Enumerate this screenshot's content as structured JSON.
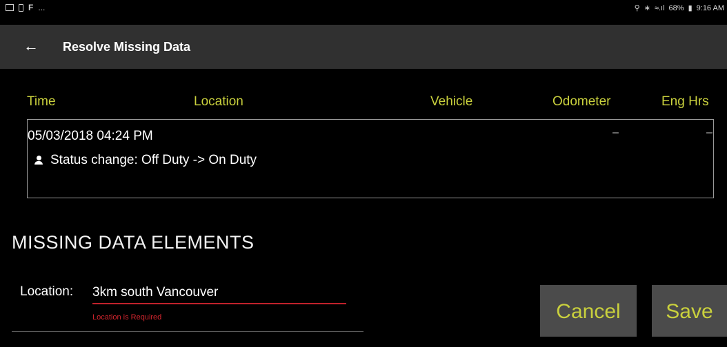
{
  "status_bar": {
    "left_icons": [
      "image-notification-icon",
      "phone-notification-icon",
      "flipboard-icon",
      "more-notifications-icon"
    ],
    "more_text": "...",
    "battery": "68%",
    "time": "9:16 AM"
  },
  "toolbar": {
    "title": "Resolve Missing Data",
    "back_icon": "arrow-back-icon"
  },
  "table": {
    "columns": [
      "Time",
      "Location",
      "Vehicle",
      "Odometer",
      "Eng Hrs"
    ],
    "rows": [
      {
        "time": "05/03/2018 04:24 PM",
        "status": "Status change: Off Duty -> On Duty",
        "odometer": "–",
        "eng_hrs": "–"
      }
    ]
  },
  "missing": {
    "title": "MISSING DATA ELEMENTS",
    "location_label": "Location:",
    "location_value": "3km south Vancouver",
    "location_error": "Location is Required"
  },
  "buttons": {
    "cancel": "Cancel",
    "save": "Save"
  },
  "colors": {
    "accent": "#c9d03d",
    "toolbar_bg": "#303030",
    "error": "#d7262f",
    "button_bg": "#4b4b4b"
  }
}
